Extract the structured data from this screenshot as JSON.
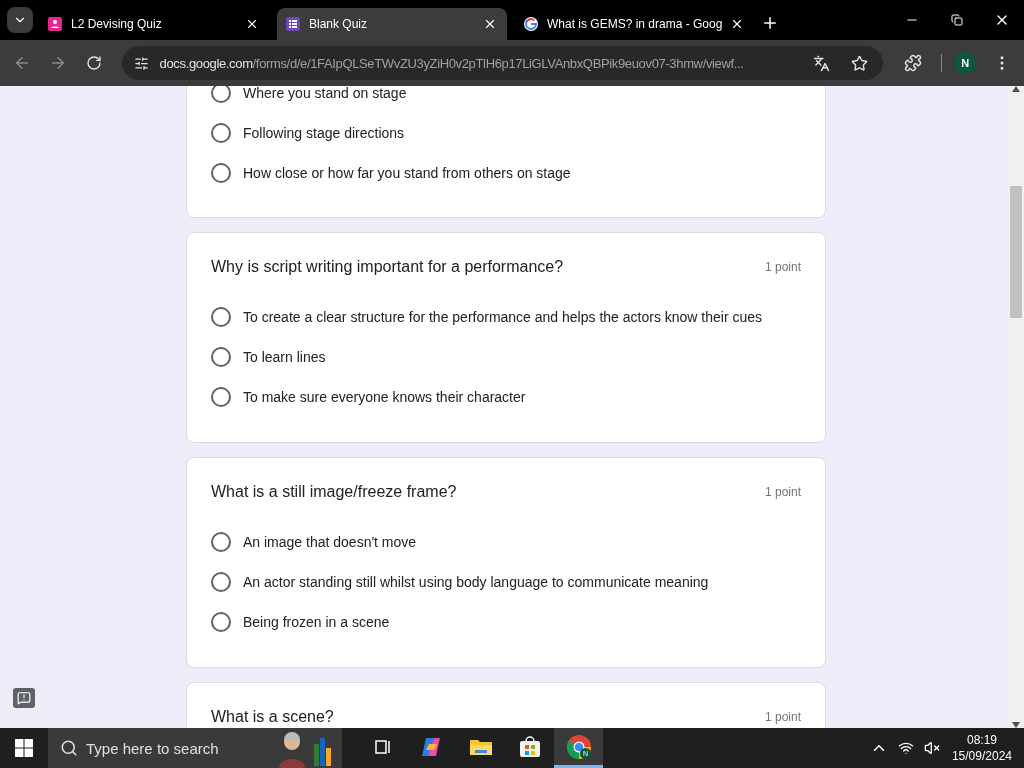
{
  "tabs": [
    {
      "title": "L2 Devising Quiz",
      "kind": "form",
      "selected": false
    },
    {
      "title": "Blank Quiz",
      "kind": "quiz",
      "selected": true
    },
    {
      "title": "What is GEMS? in drama - Goog",
      "kind": "google",
      "selected": false
    }
  ],
  "address": {
    "domain": "docs.google.com",
    "path": "/forms/d/e/1FAIpQLSeTWvZU3yZiH0v2pTlH6p17LiGLVAnbxQBPik9euov07-3hmw/viewf..."
  },
  "profile": {
    "initial": "N"
  },
  "questions": [
    {
      "kind": "partial",
      "options": [
        {
          "label": "Where you stand on stage",
          "selected": false
        },
        {
          "label": "Following stage directions",
          "selected": false
        },
        {
          "label": "How close or how far you stand from others on stage",
          "selected": false
        }
      ]
    },
    {
      "kind": "full",
      "title": "Why is script writing important for a performance?",
      "points": "1 point",
      "options": [
        {
          "label": "To create a clear structure for the performance and helps the actors know their cues",
          "selected": false
        },
        {
          "label": "To learn lines",
          "selected": false
        },
        {
          "label": "To make sure everyone knows their character",
          "selected": false
        }
      ]
    },
    {
      "kind": "full",
      "title": "What is a still image/freeze frame?",
      "points": "1 point",
      "options": [
        {
          "label": "An image that doesn't move",
          "selected": false
        },
        {
          "label": "An actor standing still whilst using body language to communicate meaning",
          "selected": false
        },
        {
          "label": "Being frozen in a scene",
          "selected": false
        }
      ]
    },
    {
      "kind": "full",
      "title": "What is a scene?",
      "points": "1 point"
    }
  ],
  "taskbar": {
    "search_placeholder": "Type here to search",
    "apps": [
      {
        "kind": "taskview",
        "selected": false
      },
      {
        "kind": "copilot",
        "selected": false
      },
      {
        "kind": "explorer",
        "selected": false
      },
      {
        "kind": "store",
        "selected": false
      },
      {
        "kind": "chrome",
        "selected": true,
        "badge": "N"
      }
    ],
    "time": "08:19",
    "date": "15/09/2024"
  }
}
